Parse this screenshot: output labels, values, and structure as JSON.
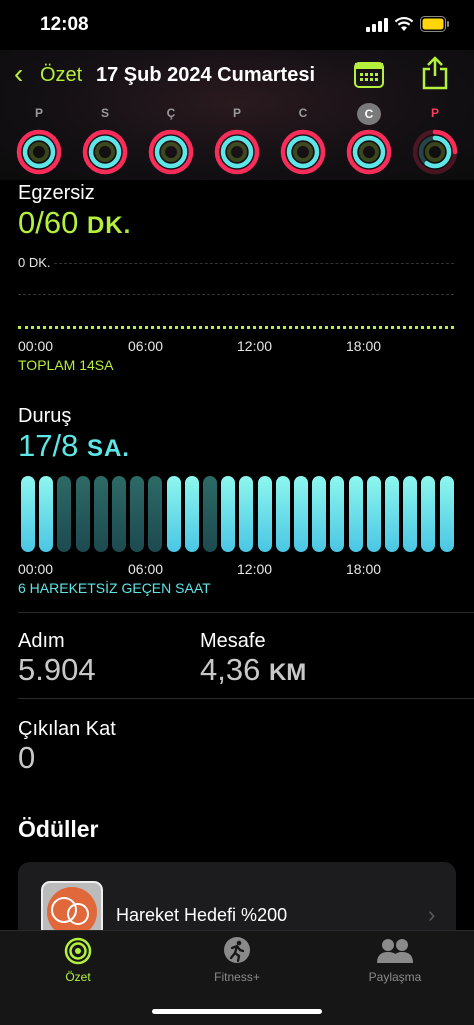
{
  "status_bar": {
    "time": "12:08"
  },
  "nav": {
    "back_label": "Özet",
    "title": "17 Şub 2024 Cumartesi"
  },
  "week": {
    "days": [
      "P",
      "S",
      "Ç",
      "P",
      "C",
      "C",
      "P"
    ],
    "selected_index": 5,
    "today_index": 6
  },
  "exercise": {
    "title": "Egzersiz",
    "value": "0/60",
    "unit": "DK.",
    "axis_max_label": "0 DK.",
    "ticks": [
      "00:00",
      "06:00",
      "12:00",
      "18:00"
    ],
    "caption": "TOPLAM 14SA"
  },
  "stand": {
    "title": "Duruş",
    "value": "17/8",
    "unit": "SA.",
    "ticks": [
      "00:00",
      "06:00",
      "12:00",
      "18:00"
    ],
    "caption": "6 HAREKETSİZ GEÇEN SAAT",
    "hours_active": [
      1,
      1,
      0,
      0,
      0,
      0,
      0,
      0,
      1,
      1,
      0,
      1,
      1,
      1,
      1,
      1,
      1,
      1,
      1,
      1,
      1,
      1,
      1,
      1
    ]
  },
  "stats": {
    "steps_label": "Adım",
    "steps_value": "5.904",
    "distance_label": "Mesafe",
    "distance_value": "4,36",
    "distance_unit": "KM",
    "floors_label": "Çıkılan Kat",
    "floors_value": "0"
  },
  "awards": {
    "title": "Ödüller",
    "item_label": "Hareket Hedefi %200"
  },
  "tabs": [
    {
      "label": "Özet",
      "active": true
    },
    {
      "label": "Fitness+",
      "active": false
    },
    {
      "label": "Paylaşma",
      "active": false
    }
  ],
  "colors": {
    "move": "#fa2d5a",
    "exercise": "#b4f03c",
    "stand": "#5ee6e6",
    "accent": "#b4f03c"
  }
}
